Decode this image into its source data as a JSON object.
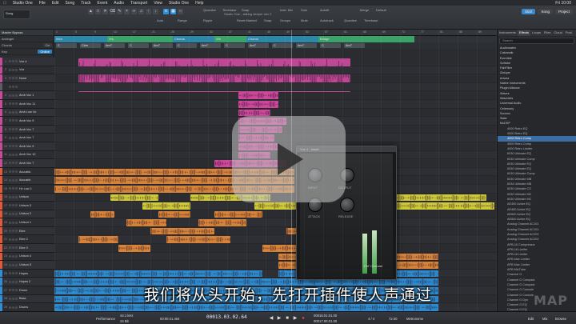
{
  "menubar": {
    "app_name": "Studio One",
    "items": [
      "File",
      "Edit",
      "Song",
      "Track",
      "Event",
      "Audio",
      "Transport",
      "View",
      "Studio One",
      "Help"
    ],
    "clock": "Fri 10:00"
  },
  "window_title": "Studio One - talking deeper mix 2",
  "toolbar": {
    "song_label": "Song",
    "labels": [
      "Quantize",
      "Timebase",
      "Snap",
      "Ripple",
      "Instr. Mix",
      "Groups",
      "Solo",
      "Mute",
      "Autofit",
      "Autotrack",
      "Merge",
      "Default",
      "Quantize",
      "Timebase",
      "Snap",
      "Auto",
      "Reset Marked",
      "Range"
    ],
    "start_label": "Start",
    "song_tab": "Song",
    "project_tab": "Project"
  },
  "inspector": {
    "title": "Master Bypass",
    "rows": [
      {
        "label": "Arranger",
        "value": ""
      },
      {
        "label": "Chords",
        "value": "On"
      },
      {
        "label": "Key",
        "value": "Online"
      },
      {
        "label": "",
        "value": ""
      }
    ]
  },
  "tracks": [
    {
      "num": "1",
      "name": "Vox 4",
      "color": "#c84a9a"
    },
    {
      "num": "2",
      "name": "Vox",
      "color": "#c84a9a"
    },
    {
      "num": "3",
      "name": "None",
      "color": "#c84a9a"
    },
    {
      "num": "",
      "name": "",
      "color": "#5a5d62"
    },
    {
      "num": "4",
      "name": "Amb Vox 1",
      "color": "#c84a9a"
    },
    {
      "num": "5",
      "name": "Amb Vox 11",
      "color": "#c84a9a"
    },
    {
      "num": "6",
      "name": "Amb Low Vo",
      "color": "#c84a9a"
    },
    {
      "num": "7",
      "name": "Amb Vox 9",
      "color": "#c84a9a"
    },
    {
      "num": "8",
      "name": "Amb Vox 7",
      "color": "#c84a9a"
    },
    {
      "num": "9",
      "name": "Amb Vox 7",
      "color": "#c84a9a"
    },
    {
      "num": "10",
      "name": "Amb Vox 9",
      "color": "#c84a9a"
    },
    {
      "num": "11",
      "name": "Amb Vox 12",
      "color": "#c84a9a"
    },
    {
      "num": "12",
      "name": "Amb Vox 7",
      "color": "#c84a9a"
    },
    {
      "num": "13",
      "name": "Acoustic",
      "color": "#e05a3a"
    },
    {
      "num": "14",
      "name": "Acoustic",
      "color": "#e05a3a"
    },
    {
      "num": "15",
      "name": "Hv Low 1",
      "color": "#e05a3a"
    },
    {
      "num": "16",
      "name": "Unison",
      "color": "#e05a3a"
    },
    {
      "num": "17",
      "name": "Unison 3",
      "color": "#e05a3a"
    },
    {
      "num": "18",
      "name": "Unison 2",
      "color": "#e05a3a"
    },
    {
      "num": "19",
      "name": "Unison 1",
      "color": "#e05a3a"
    },
    {
      "num": "20",
      "name": "Elee",
      "color": "#e05a3a"
    },
    {
      "num": "21",
      "name": "Elee 2",
      "color": "#e05a3a"
    },
    {
      "num": "22",
      "name": "Elee 3",
      "color": "#e05a3a"
    },
    {
      "num": "23",
      "name": "Unison 4",
      "color": "#e05a3a"
    },
    {
      "num": "24",
      "name": "Unison 5",
      "color": "#e05a3a"
    },
    {
      "num": "25",
      "name": "Hopes",
      "color": "#2e8fd6"
    },
    {
      "num": "26",
      "name": "Hopes 2",
      "color": "#2e8fd6"
    },
    {
      "num": "27",
      "name": "Drone",
      "color": "#2e8fd6"
    },
    {
      "num": "28",
      "name": "Bass",
      "color": "#2e8fd6"
    },
    {
      "num": "29",
      "name": "Drums",
      "color": "#2e8fd6"
    }
  ],
  "markers": [
    {
      "label": "Intro",
      "color": "#2c88a8"
    },
    {
      "label": "Vrs",
      "color": "#3aa36a"
    },
    {
      "label": "Chorus",
      "color": "#2c88a8"
    },
    {
      "label": "Vrs",
      "color": "#3aa36a"
    },
    {
      "label": "Chorus",
      "color": "#2c88a8"
    },
    {
      "label": "Bridge",
      "color": "#3aa36a"
    }
  ],
  "chords": [
    "C",
    "C#m",
    "Am7",
    "C",
    "Am7",
    "C",
    "Am7",
    "C",
    "Am7",
    "C",
    "Am7",
    "C",
    "Am7"
  ],
  "plugin": {
    "title": "Vox 4 - Insert",
    "name": "FAT Channel",
    "labels": [
      "INPUT",
      "OUTPUT",
      "ATTACK",
      "RELEASE"
    ]
  },
  "browser": {
    "tabs": [
      "Instruments",
      "Effects",
      "Loops",
      "Files",
      "Cloud",
      "Pool"
    ],
    "search_placeholder": "Search",
    "folders": [
      "Audiomatrix",
      "Cakewalk",
      "Eventide",
      "Softube",
      "FabFilter",
      "iZotope",
      "Arturia",
      "Native Instruments",
      "Plugin Alliance",
      "Waves",
      "WaveArts",
      "Universal Audio",
      "Celemony",
      "Sonnox",
      "Slate",
      "McDSP"
    ],
    "plugins": [
      "4000 Retro EQ",
      "4000 Retro EQ",
      "4000 Retro Comp",
      "4000 Retro Comp",
      "4000 Retro Limiter",
      "6030 Ultimate EQ",
      "6030 Ultimate Comp",
      "6030 Ultimate EQ",
      "6030 Ultimate EQ",
      "6030 Ultimate Comp",
      "6030 Ultimate MB",
      "6034 Ultimate MB",
      "6030 Ultimate CS",
      "6030 Ultimate MC",
      "6030 Ultimate MC",
      "AE400 Active EQ",
      "AE400 Active EQ",
      "AE600 Active EQ",
      "AE600 Active EQ",
      "Analog Channel AC101",
      "Analog Channel AC101",
      "Analog Channel AC202",
      "Analog Channel AC202",
      "APB-16 Compressor",
      "APB-16 Limiter",
      "APB-16 Limiter",
      "APB Max Limiter",
      "APB Max Limiter",
      "APB MixTube",
      "Channel G",
      "Channel G Compact",
      "Channel G Compact",
      "Channel G Console",
      "Channel G Console",
      "Channel G Dyn",
      "Channel G EQ",
      "Channel G EQ",
      "Channel G Surround",
      "Channel G Surround"
    ],
    "selected": "4000 Retro Comp"
  },
  "transport": {
    "sample_rate": "44.1 kHz",
    "bit_depth": "24 Bit",
    "perf": "Performance",
    "time": "00:00:41.464",
    "bars": "00013.03.02.64",
    "loop_start": "00016.01.01.00",
    "loop_end": "00017.00.01.00",
    "tempo": "72.00",
    "metronome": "Metronome",
    "edit": "Edit",
    "mix": "Mix",
    "browse": "Browse",
    "signature": "4 / 4"
  },
  "subtitle": "我们将从头开始，先打开插件使人声通过",
  "watermark": "MAP",
  "colors": {
    "vocal": "#c84a9a",
    "amb": "#d548a0",
    "yellow": "#d8d238",
    "orange": "#e0883a",
    "blue": "#2e8fd6",
    "accent": "#2e8fd6"
  }
}
